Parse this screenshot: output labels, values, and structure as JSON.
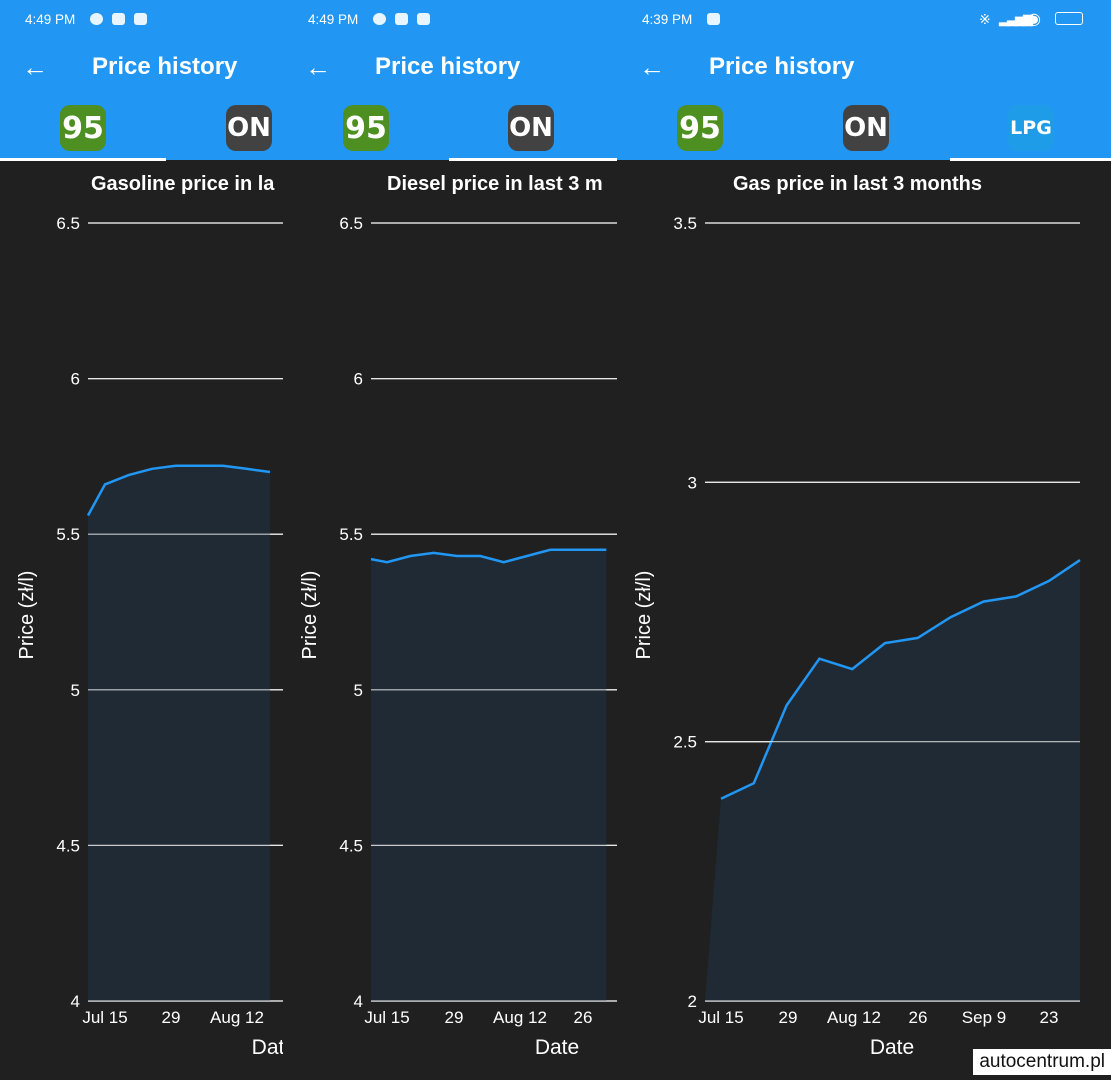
{
  "watermark": "autocentrum.pl",
  "colors": {
    "primary": "#2196F3",
    "line": "#2196F3",
    "fill": "#1F2A35",
    "background": "#202020"
  },
  "panels": [
    {
      "time": "4:49 PM",
      "app_title": "Price history",
      "tabs": [
        "95",
        "ON"
      ],
      "chart_title": "Gasoline price in la",
      "ylabel": "Price (zł/l)",
      "xlabel": "Dat"
    },
    {
      "time": "4:49 PM",
      "app_title": "Price history",
      "tabs": [
        "95",
        "ON"
      ],
      "chart_title": "Diesel price in last 3 m",
      "ylabel": "Price (zł/l)",
      "xlabel": "Date"
    },
    {
      "time": "4:39 PM",
      "app_title": "Price history",
      "tabs": [
        "95",
        "ON",
        "LPG"
      ],
      "chart_title": "Gas price in last 3 months",
      "ylabel": "Price (zł/l)",
      "xlabel": "Date"
    }
  ],
  "chart_data": [
    {
      "type": "area",
      "title": "Gasoline price in la",
      "ylabel": "Price (zł/l)",
      "xlabel": "Dat",
      "ylim": [
        4,
        6.5
      ],
      "yticks": [
        "6.5",
        "6",
        "5.5",
        "5",
        "4.5",
        "4"
      ],
      "xticks": [
        "Jul 15",
        "29",
        "Aug 12"
      ],
      "grid": true,
      "series": [
        {
          "x": [
            "Jul 10",
            "Jul 15",
            "Jul 20",
            "Jul 25",
            "Jul 30",
            "Aug 4",
            "Aug 9",
            "Aug 14",
            "Aug 19"
          ],
          "values": [
            5.56,
            5.66,
            5.69,
            5.71,
            5.72,
            5.72,
            5.72,
            5.71,
            5.7
          ]
        }
      ]
    },
    {
      "type": "area",
      "title": "Diesel price in last 3 m",
      "ylabel": "Price (zł/l)",
      "xlabel": "Date",
      "ylim": [
        4,
        6.5
      ],
      "yticks": [
        "6.5",
        "6",
        "5.5",
        "5",
        "4.5",
        "4"
      ],
      "xticks": [
        "Jul 15",
        "29",
        "Aug 12",
        "26"
      ],
      "grid": true,
      "series": [
        {
          "x": [
            "Jul 10",
            "Jul 15",
            "Jul 20",
            "Jul 25",
            "Jul 30",
            "Aug 4",
            "Aug 9",
            "Aug 14",
            "Aug 19",
            "Aug 24",
            "Aug 29",
            "Aug 31"
          ],
          "values": [
            5.42,
            5.41,
            5.43,
            5.44,
            5.43,
            5.43,
            5.41,
            5.43,
            5.45,
            5.45,
            5.45,
            5.45
          ]
        }
      ]
    },
    {
      "type": "area",
      "title": "Gas price in last 3 months",
      "ylabel": "Price (zł/l)",
      "xlabel": "Date",
      "ylim": [
        2,
        3.5
      ],
      "yticks": [
        "3.5",
        "3",
        "2.5",
        "2"
      ],
      "xticks": [
        "Jul 15",
        "29",
        "Aug 12",
        "26",
        "Sep 9",
        "23"
      ],
      "grid": true,
      "series": [
        {
          "x": [
            "Jul 15",
            "Jul 22",
            "Jul 29",
            "Aug 5",
            "Aug 12",
            "Aug 19",
            "Aug 26",
            "Sep 2",
            "Sep 9",
            "Sep 16",
            "Sep 23",
            "Sep 30"
          ],
          "values": [
            2.39,
            2.42,
            2.57,
            2.66,
            2.64,
            2.69,
            2.7,
            2.74,
            2.77,
            2.78,
            2.81,
            2.85
          ]
        }
      ]
    }
  ]
}
